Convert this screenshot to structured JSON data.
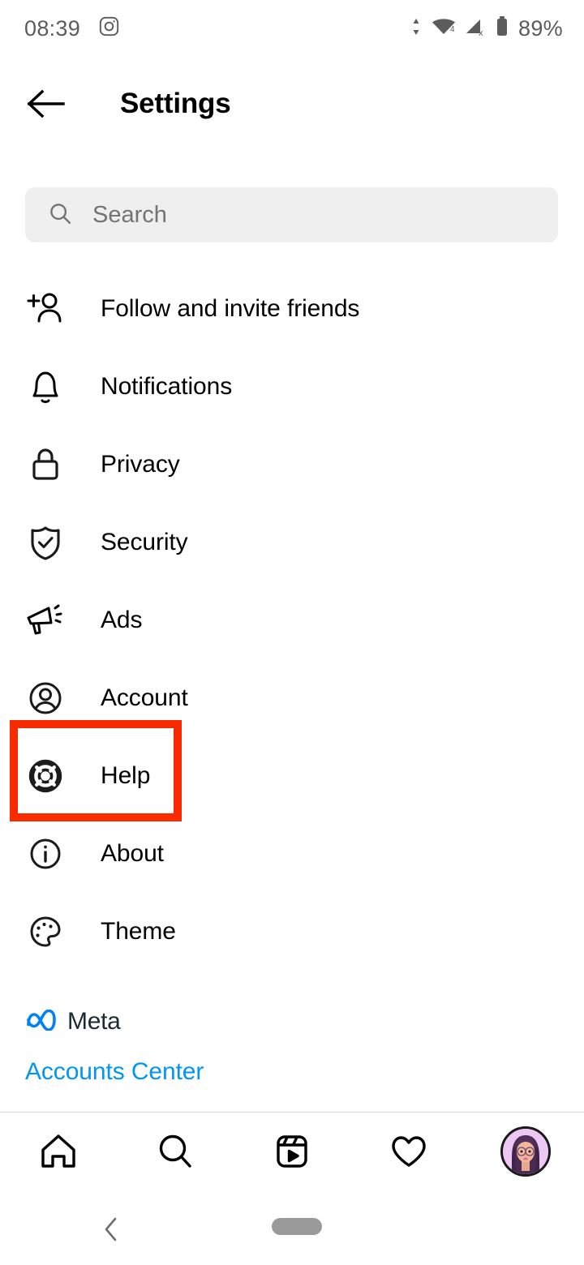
{
  "status_bar": {
    "time": "08:39",
    "app_notification_icon": "instagram-icon",
    "data_transfer_icon": "data-transfer-arrows-icon",
    "wifi_icon": "wifi-icon",
    "wifi_badge": "4",
    "cellular_icon": "cellular-signal-off-icon",
    "cellular_badge": "x",
    "battery_icon": "battery-icon",
    "battery_percent": "89%"
  },
  "header": {
    "back_icon": "back-arrow-icon",
    "title": "Settings"
  },
  "search": {
    "icon": "search-icon",
    "placeholder": "Search",
    "value": ""
  },
  "menu": {
    "items": [
      {
        "label": "Follow and invite friends",
        "icon": "person-add-icon"
      },
      {
        "label": "Notifications",
        "icon": "bell-icon"
      },
      {
        "label": "Privacy",
        "icon": "lock-icon"
      },
      {
        "label": "Security",
        "icon": "shield-check-icon"
      },
      {
        "label": "Ads",
        "icon": "megaphone-icon"
      },
      {
        "label": "Account",
        "icon": "person-circle-icon"
      },
      {
        "label": "Help",
        "icon": "life-ring-icon"
      },
      {
        "label": "About",
        "icon": "info-circle-icon"
      },
      {
        "label": "Theme",
        "icon": "palette-icon"
      }
    ]
  },
  "annotation": {
    "target_label": "Help",
    "color": "#FA2A00"
  },
  "footer": {
    "meta_logo_icon": "meta-infinity-icon",
    "meta_wordmark": "Meta",
    "accounts_center_label": "Accounts Center",
    "link_color": "#0095f6"
  },
  "bottom_nav": {
    "items": [
      {
        "icon": "home-icon",
        "label": "Home"
      },
      {
        "icon": "search-icon",
        "label": "Search"
      },
      {
        "icon": "reels-icon",
        "label": "Reels"
      },
      {
        "icon": "heart-icon",
        "label": "Activity"
      },
      {
        "icon": "profile-avatar-icon",
        "label": "Profile"
      }
    ]
  },
  "system_nav": {
    "back_icon": "system-back-chevron-icon",
    "home_indicator": "home-pill-indicator"
  }
}
